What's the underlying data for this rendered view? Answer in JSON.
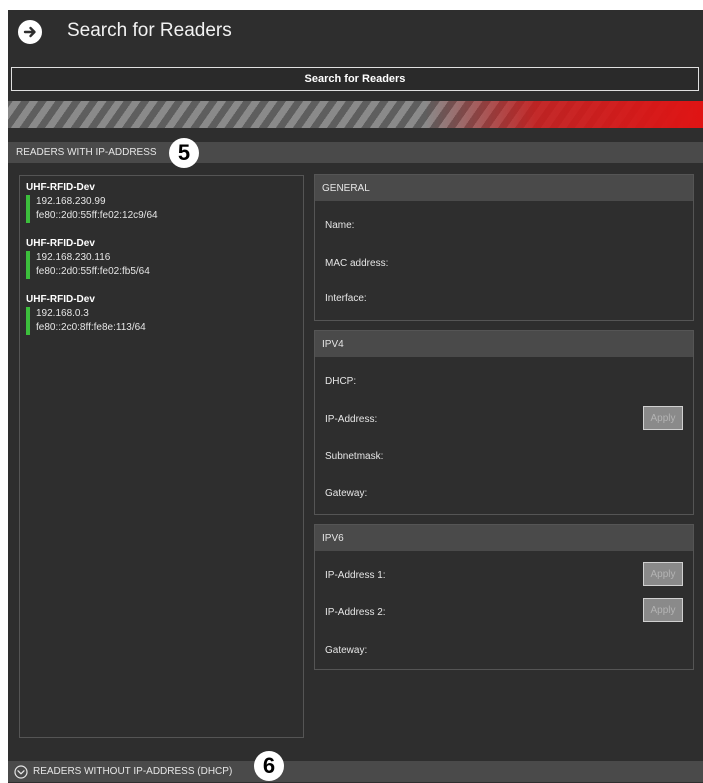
{
  "header": {
    "title": "Search for Readers",
    "back_icon": "arrow-right-circle-icon"
  },
  "search": {
    "button_label": "Search for Readers"
  },
  "progress": {
    "value": 0.4,
    "fill_color": "#e01414"
  },
  "sections": {
    "with_ip": {
      "label": "READERS WITH IP-ADDRESS",
      "callout": "5"
    },
    "without_ip": {
      "label": "READERS WITHOUT IP-ADDRESS (DHCP)",
      "callout": "6",
      "icon": "chevron-down-circle-icon"
    }
  },
  "readers": [
    {
      "name": "UHF-RFID-Dev",
      "ipv4": "192.168.230.99",
      "ipv6": "fe80::2d0:55ff:fe02:12c9/64"
    },
    {
      "name": "UHF-RFID-Dev",
      "ipv4": "192.168.230.116",
      "ipv6": "fe80::2d0:55ff:fe02:fb5/64"
    },
    {
      "name": "UHF-RFID-Dev",
      "ipv4": "192.168.0.3",
      "ipv6": "fe80::2c0:8ff:fe8e:113/64"
    }
  ],
  "general": {
    "header": "GENERAL",
    "name_label": "Name:",
    "mac_label": "MAC address:",
    "interface_label": "Interface:"
  },
  "ipv4": {
    "header": "IPV4",
    "dhcp_label": "DHCP:",
    "ip_label": "IP-Address:",
    "subnet_label": "Subnetmask:",
    "gateway_label": "Gateway:",
    "apply_label": "Apply"
  },
  "ipv6": {
    "header": "IPV6",
    "ip1_label": "IP-Address 1:",
    "ip2_label": "IP-Address 2:",
    "gateway_label": "Gateway:",
    "apply1_label": "Apply",
    "apply2_label": "Apply"
  },
  "colors": {
    "background": "#2e2e2e",
    "section": "#4a4a4a",
    "status_green": "#3cbf3c"
  }
}
